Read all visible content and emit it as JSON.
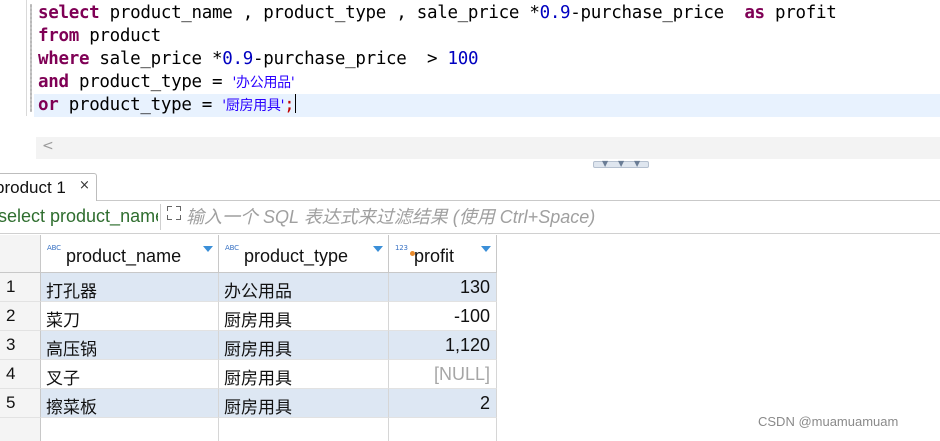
{
  "editor": {
    "lines": [
      {
        "tokens": [
          {
            "t": "select",
            "k": "kw"
          },
          {
            "t": " product_name , product_type , sale_price *",
            "k": "plain"
          },
          {
            "t": "0.9",
            "k": "num"
          },
          {
            "t": "-purchase_price  ",
            "k": "plain"
          },
          {
            "t": "as",
            "k": "kw"
          },
          {
            "t": " profit",
            "k": "plain"
          }
        ]
      },
      {
        "tokens": [
          {
            "t": "from",
            "k": "kw"
          },
          {
            "t": " product",
            "k": "plain"
          }
        ]
      },
      {
        "tokens": [
          {
            "t": "where",
            "k": "kw"
          },
          {
            "t": " sale_price *",
            "k": "plain"
          },
          {
            "t": "0.9",
            "k": "num"
          },
          {
            "t": "-purchase_price  > ",
            "k": "plain"
          },
          {
            "t": "100",
            "k": "num"
          }
        ]
      },
      {
        "tokens": [
          {
            "t": "and",
            "k": "kw"
          },
          {
            "t": " product_type = ",
            "k": "plain"
          },
          {
            "t": "'办公用品'",
            "k": "str"
          }
        ]
      },
      {
        "tokens": [
          {
            "t": "or",
            "k": "kw"
          },
          {
            "t": " product_type = ",
            "k": "plain"
          },
          {
            "t": "'厨房用具'",
            "k": "str"
          },
          {
            "t": ";",
            "k": "red"
          }
        ]
      }
    ],
    "scroll_left_glyph": "<"
  },
  "result_tab": {
    "label": "product 1",
    "close_glyph": "×"
  },
  "filter": {
    "query_text": "select product_name",
    "placeholder": "输入一个 SQL 表达式来过滤结果 (使用 Ctrl+Space)"
  },
  "grid": {
    "columns": [
      {
        "type_badge": "ABC",
        "label": "product_name",
        "kind": "text"
      },
      {
        "type_badge": "ABC",
        "label": "product_type",
        "kind": "text"
      },
      {
        "type_badge": "123",
        "label": "profit",
        "kind": "number"
      }
    ],
    "rows": [
      {
        "num": "1",
        "cells": [
          "打孔器",
          "办公用品",
          "130"
        ]
      },
      {
        "num": "2",
        "cells": [
          "菜刀",
          "厨房用具",
          "-100"
        ]
      },
      {
        "num": "3",
        "cells": [
          "高压锅",
          "厨房用具",
          "1,120"
        ]
      },
      {
        "num": "4",
        "cells": [
          "叉子",
          "厨房用具",
          "[NULL]"
        ]
      },
      {
        "num": "5",
        "cells": [
          "擦菜板",
          "厨房用具",
          "2"
        ]
      }
    ]
  },
  "watermark": "CSDN @muamuamuam",
  "colors": {
    "keyword": "#7f0055",
    "number": "#0000c0",
    "string": "#2a00ff",
    "current_line": "#e8f2fe",
    "alt_row": "#dde7f3",
    "sort_arrow": "#3b8fd8"
  }
}
